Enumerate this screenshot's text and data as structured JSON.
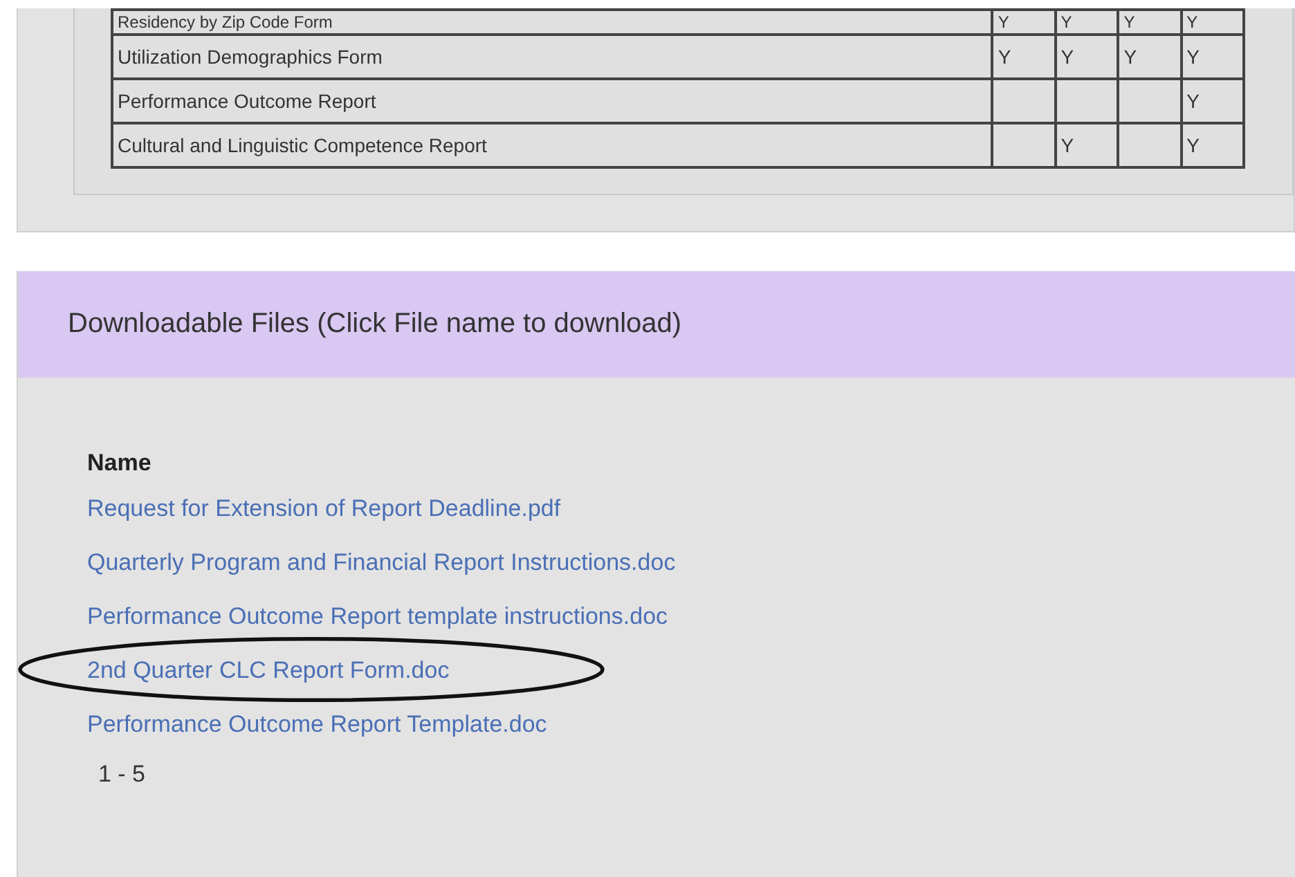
{
  "forms_table": {
    "rows": [
      {
        "name": "Residency by Zip Code Form",
        "cells": [
          "Y",
          "Y",
          "Y",
          "Y"
        ]
      },
      {
        "name": "Utilization Demographics Form",
        "cells": [
          "Y",
          "Y",
          "Y",
          "Y"
        ]
      },
      {
        "name": "Performance Outcome Report",
        "cells": [
          "",
          "",
          "",
          "Y"
        ]
      },
      {
        "name": "Cultural and Linguistic Competence Report",
        "cells": [
          "",
          "Y",
          "",
          "Y"
        ]
      }
    ]
  },
  "downloads": {
    "title": "Downloadable Files (Click File name to download)",
    "column_header": "Name",
    "files": [
      {
        "name": "Request for Extension of Report Deadline.pdf",
        "circled": false
      },
      {
        "name": "Quarterly Program and Financial Report Instructions.doc",
        "circled": false
      },
      {
        "name": "Performance Outcome Report template instructions.doc",
        "circled": false
      },
      {
        "name": "2nd Quarter CLC Report Form.doc",
        "circled": true
      },
      {
        "name": "Performance Outcome Report Template.doc",
        "circled": false
      }
    ],
    "paging": "1 - 5"
  }
}
